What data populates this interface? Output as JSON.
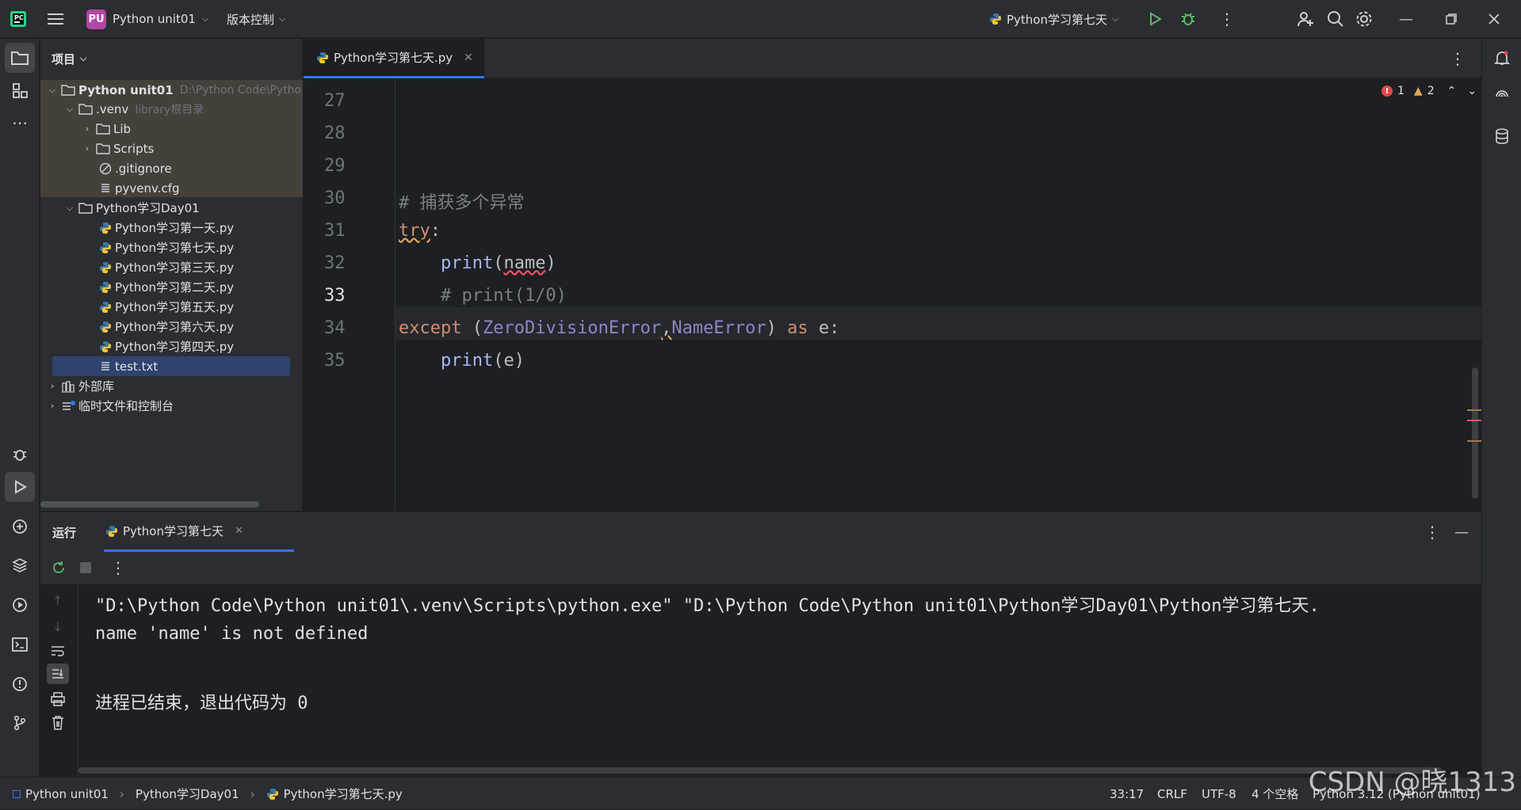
{
  "titlebar": {
    "project_badge": "PU",
    "project_name": "Python unit01",
    "vcs": "版本控制",
    "run_config": "Python学习第七天"
  },
  "project_panel": {
    "title": "项目",
    "tree": [
      {
        "label": "Python unit01",
        "extra": "D:\\Python Code\\Pytho"
      },
      {
        "label": ".venv",
        "extra": "library根目录"
      },
      {
        "label": "Lib"
      },
      {
        "label": "Scripts"
      },
      {
        "label": ".gitignore"
      },
      {
        "label": "pyvenv.cfg"
      },
      {
        "label": "Python学习Day01"
      },
      {
        "label": "Python学习第一天.py"
      },
      {
        "label": "Python学习第七天.py"
      },
      {
        "label": "Python学习第三天.py"
      },
      {
        "label": "Python学习第二天.py"
      },
      {
        "label": "Python学习第五天.py"
      },
      {
        "label": "Python学习第六天.py"
      },
      {
        "label": "Python学习第四天.py"
      },
      {
        "label": "test.txt"
      },
      {
        "label": "外部库"
      },
      {
        "label": "临时文件和控制台"
      }
    ]
  },
  "editor": {
    "tab_label": "Python学习第七天.py",
    "errors": "1",
    "warnings": "2",
    "line_numbers": [
      "27",
      "28",
      "29",
      "30",
      "31",
      "32",
      "33",
      "34",
      "35"
    ],
    "code": {
      "l30": "# 捕获多个异常",
      "l31_kw": "try",
      "l31_rest": ":",
      "l32_fn": "print",
      "l32_open": "(",
      "l32_arg": "name",
      "l32_close": ")",
      "l33": "# print(1/0)",
      "l34_kw": "except",
      "l34_open": " (",
      "l34_c1": "ZeroDivisionError",
      "l34_comma": ",",
      "l34_c2": "NameError",
      "l34_close": ") ",
      "l34_as": "as",
      "l34_rest": " e:",
      "l35_fn": "print",
      "l35_rest": "(e)"
    }
  },
  "run_panel": {
    "title": "运行",
    "tab": "Python学习第七天",
    "console": [
      "\"D:\\Python Code\\Python unit01\\.venv\\Scripts\\python.exe\" \"D:\\Python Code\\Python unit01\\Python学习Day01\\Python学习第七天.",
      "name 'name' is not defined",
      "",
      "进程已结束，退出代码为 0"
    ]
  },
  "statusbar": {
    "crumbs": [
      "Python unit01",
      "Python学习Day01",
      "Python学习第七天.py"
    ],
    "position": "33:17",
    "line_sep": "CRLF",
    "encoding": "UTF-8",
    "indent": "4 个空格",
    "interpreter": "Python 3.12 (Python unit01)"
  },
  "watermark": "CSDN @晓1313",
  "colors": {
    "accent": "#3574f0",
    "keyword": "#cf8e6d",
    "error": "#f75464"
  }
}
